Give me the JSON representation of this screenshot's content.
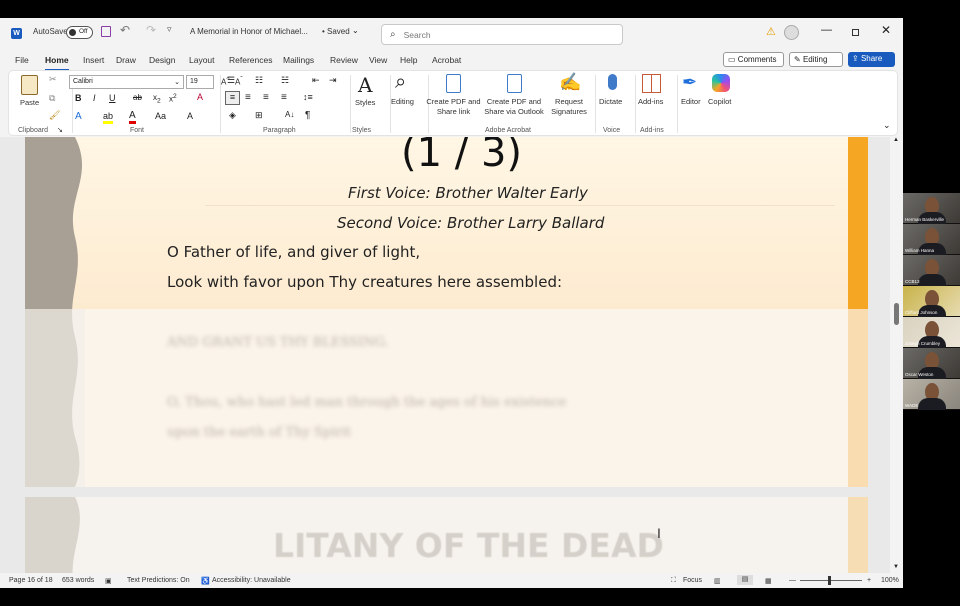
{
  "titlebar": {
    "autosave_label": "AutoSave",
    "autosave_state": "Off",
    "doc_title": "A Memorial in Honor of Michael...",
    "saved_status": "• Saved",
    "search_placeholder": "Search"
  },
  "menu": [
    "File",
    "Home",
    "Insert",
    "Draw",
    "Design",
    "Layout",
    "References",
    "Mailings",
    "Review",
    "View",
    "Help",
    "Acrobat"
  ],
  "menu_active": "Home",
  "actions": {
    "comments": "Comments",
    "editing": "Editing",
    "share": "Share"
  },
  "ribbon": {
    "paste": "Paste",
    "font_name": "Calibri",
    "font_size": "19",
    "styles": "Styles",
    "editing": "Editing",
    "create_pdf_share": "Create PDF and Share link",
    "create_pdf_outlook": "Create PDF and Share via Outlook",
    "request_signatures": "Request Signatures",
    "dictate": "Dictate",
    "addins": "Add-ins",
    "editor": "Editor",
    "copilot": "Copilot",
    "groups": {
      "clipboard": "Clipboard",
      "font": "Font",
      "paragraph": "Paragraph",
      "styles": "Styles",
      "adobe": "Adobe Acrobat",
      "voice": "Voice",
      "addins": "Add-ins"
    }
  },
  "document": {
    "heading": "(1 / 3)",
    "voice1": "First Voice: Brother Walter Early",
    "voice2": "Second Voice: Brother Larry Ballard",
    "line1": "O Father of life, and giver of light,",
    "line2": "Look with favor upon Thy creatures here assembled:",
    "faded1": "AND GRANT US THY BLESSING.",
    "faded2": "O, Thou, who hast led man through the ages of his existence",
    "faded3": "upon the earth of Thy Spirit",
    "next_heading": "LITANY OF THE DEAD"
  },
  "status": {
    "page": "Page 16 of 18",
    "words": "653 words",
    "predictions": "Text Predictions: On",
    "accessibility": "Accessibility: Unavailable",
    "focus": "Focus",
    "zoom": "100%"
  },
  "participants": [
    "Herman Baskerville",
    "William Hanna",
    "CCB13",
    "Clifford Johnson",
    "Joseph Crumbley",
    "Oscar Weston",
    "WADE"
  ]
}
